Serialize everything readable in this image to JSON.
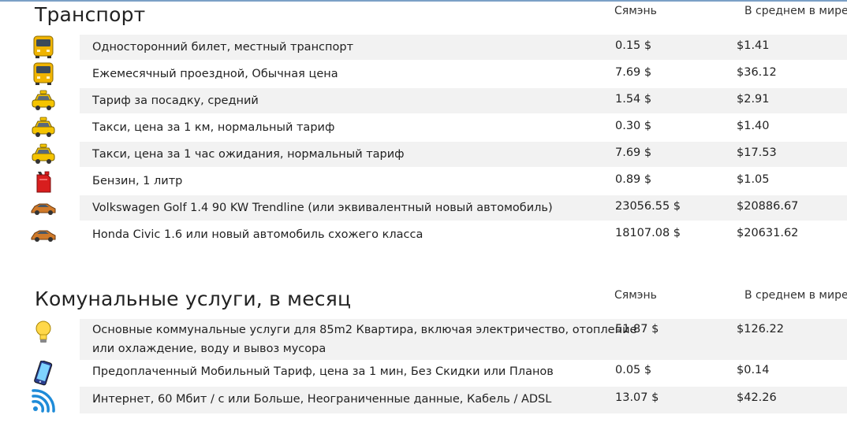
{
  "transport": {
    "title": "Транспорт",
    "col_city": "Сямэнь",
    "col_world": "В среднем в мире",
    "rows": [
      {
        "label": "Односторонний билет, местный транспорт",
        "city": "0.15 $",
        "world": "$1.41",
        "icon": "bus-icon"
      },
      {
        "label": "Ежемесячный проездной, Обычная цена",
        "city": "7.69 $",
        "world": "$36.12",
        "icon": "bus-icon"
      },
      {
        "label": "Тариф за посадку, средний",
        "city": "1.54 $",
        "world": "$2.91",
        "icon": "taxi-icon"
      },
      {
        "label": "Такси, цена за 1 км, нормальный тариф",
        "city": "0.30 $",
        "world": "$1.40",
        "icon": "taxi-icon"
      },
      {
        "label": "Такси, цена за 1 час ожидания, нормальный тариф",
        "city": "7.69 $",
        "world": "$17.53",
        "icon": "taxi-icon"
      },
      {
        "label": "Бензин, 1 литр",
        "city": "0.89 $",
        "world": "$1.05",
        "icon": "fuel-can-icon"
      },
      {
        "label": "Volkswagen Golf 1.4 90 KW Trendline (или эквивалентный новый автомобиль)",
        "city": "23056.55 $",
        "world": "$20886.67",
        "icon": "car-icon"
      },
      {
        "label": "Honda Civic 1.6 или новый автомобиль схожего класса",
        "city": "18107.08 $",
        "world": "$20631.62",
        "icon": "car-icon"
      }
    ]
  },
  "utilities": {
    "title": "Комунальные услуги, в месяц",
    "col_city": "Сямэнь",
    "col_world": "В среднем в мире",
    "rows": [
      {
        "label_line1": "Основные коммунальные услуги для 85m2 Квартира, включая электричество, отопление",
        "label_line2": "или охлаждение, воду и вывоз мусора",
        "city": "51.87 $",
        "world": "$126.22",
        "icon": "light-bulb-icon"
      },
      {
        "label": "Предоплаченный Мобильный Тариф, цена за 1 мин, Без Скидки или Планов",
        "city": "0.05 $",
        "world": "$0.14",
        "icon": "mobile-phone-icon"
      },
      {
        "label": "Интернет, 60 Мбит / с или Больше, Неограниченные данные, Кабель / ADSL",
        "city": "13.07 $",
        "world": "$42.26",
        "icon": "wifi-icon"
      }
    ]
  }
}
